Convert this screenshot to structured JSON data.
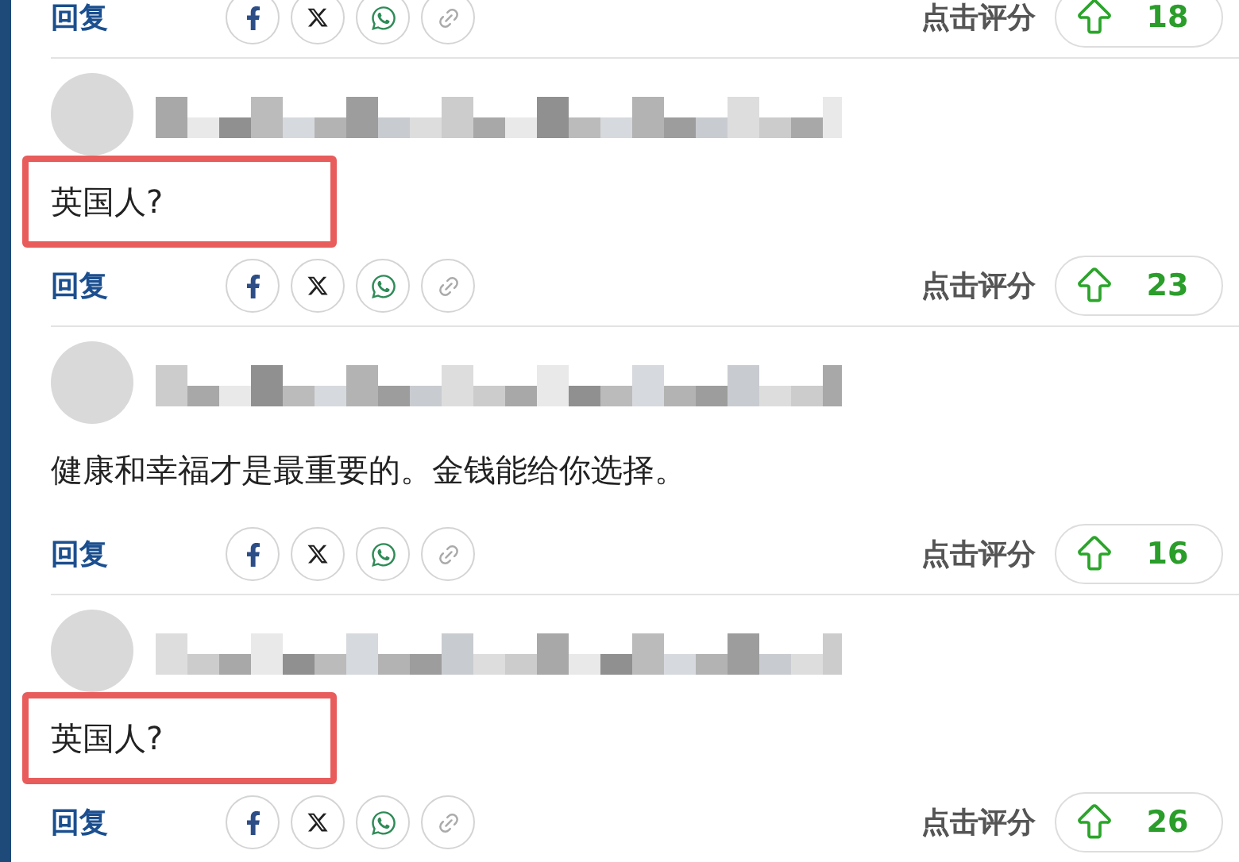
{
  "cut_off_actions": {
    "reply": "回复",
    "rating_label": "点击评分",
    "score": "18"
  },
  "comments": [
    {
      "text": "英国人?",
      "highlighted": true,
      "reply": "回复",
      "rating_label": "点击评分",
      "score": "23"
    },
    {
      "text": "健康和幸福才是最重要的。金钱能给你选择。",
      "highlighted": false,
      "reply": "回复",
      "rating_label": "点击评分",
      "score": "16"
    },
    {
      "text": "英国人?",
      "highlighted": true,
      "reply": "回复",
      "rating_label": "点击评分",
      "score": "26"
    }
  ]
}
